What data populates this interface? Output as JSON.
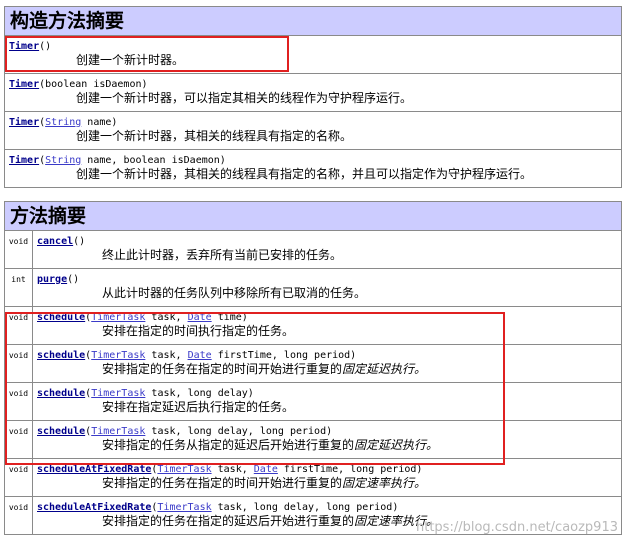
{
  "constructor_section": {
    "title": "构造方法摘要",
    "rows": [
      {
        "name": "Timer",
        "params": [],
        "description": "创建一个新计时器。"
      },
      {
        "name": "Timer",
        "params": [
          {
            "type": "boolean",
            "name": "isDaemon",
            "link": false
          }
        ],
        "description": "创建一个新计时器，可以指定其相关的线程作为守护程序运行。"
      },
      {
        "name": "Timer",
        "params": [
          {
            "type": "String",
            "name": "name",
            "link": true
          }
        ],
        "description": "创建一个新计时器，其相关的线程具有指定的名称。"
      },
      {
        "name": "Timer",
        "params": [
          {
            "type": "String",
            "name": "name",
            "link": true
          },
          {
            "type": "boolean",
            "name": "isDaemon",
            "link": false
          }
        ],
        "description": "创建一个新计时器，其相关的线程具有指定的名称，并且可以指定作为守护程序运行。"
      }
    ]
  },
  "method_section": {
    "title": "方法摘要",
    "rows": [
      {
        "return_type": "void",
        "name": "cancel",
        "params": [],
        "description": "终止此计时器，丢弃所有当前已安排的任务。",
        "italic": ""
      },
      {
        "return_type": "int",
        "name": "purge",
        "params": [],
        "description": "从此计时器的任务队列中移除所有已取消的任务。",
        "italic": ""
      },
      {
        "return_type": "void",
        "name": "schedule",
        "params": [
          {
            "type": "TimerTask",
            "name": "task",
            "link": true
          },
          {
            "type": "Date",
            "name": "time",
            "link": true
          }
        ],
        "description": "安排在指定的时间执行指定的任务。",
        "italic": ""
      },
      {
        "return_type": "void",
        "name": "schedule",
        "params": [
          {
            "type": "TimerTask",
            "name": "task",
            "link": true
          },
          {
            "type": "Date",
            "name": "firstTime",
            "link": true
          },
          {
            "type": "long",
            "name": "period",
            "link": false
          }
        ],
        "description": "安排指定的任务在指定的时间开始进行重复的",
        "italic": "固定延迟执行。"
      },
      {
        "return_type": "void",
        "name": "schedule",
        "params": [
          {
            "type": "TimerTask",
            "name": "task",
            "link": true
          },
          {
            "type": "long",
            "name": "delay",
            "link": false
          }
        ],
        "description": "安排在指定延迟后执行指定的任务。",
        "italic": ""
      },
      {
        "return_type": "void",
        "name": "schedule",
        "params": [
          {
            "type": "TimerTask",
            "name": "task",
            "link": true
          },
          {
            "type": "long",
            "name": "delay",
            "link": false
          },
          {
            "type": "long",
            "name": "period",
            "link": false
          }
        ],
        "description": "安排指定的任务从指定的延迟后开始进行重复的",
        "italic": "固定延迟执行。"
      },
      {
        "return_type": "void",
        "name": "scheduleAtFixedRate",
        "params": [
          {
            "type": "TimerTask",
            "name": "task",
            "link": true
          },
          {
            "type": "Date",
            "name": "firstTime",
            "link": true
          },
          {
            "type": "long",
            "name": "period",
            "link": false
          }
        ],
        "description": "安排指定的任务在指定的时间开始进行重复的",
        "italic": "固定速率执行。"
      },
      {
        "return_type": "void",
        "name": "scheduleAtFixedRate",
        "params": [
          {
            "type": "TimerTask",
            "name": "task",
            "link": true
          },
          {
            "type": "long",
            "name": "delay",
            "link": false
          },
          {
            "type": "long",
            "name": "period",
            "link": false
          }
        ],
        "description": "安排指定的任务在指定的延迟后开始进行重复的",
        "italic": "固定速率执行。"
      }
    ]
  },
  "watermark": "https://blog.csdn.net/caozp913"
}
